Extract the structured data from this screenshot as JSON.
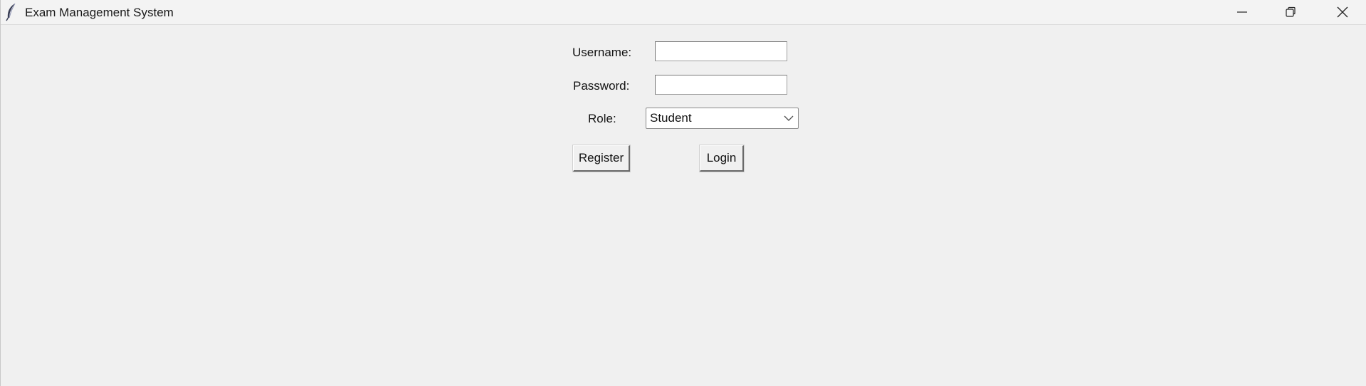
{
  "window": {
    "title": "Exam Management System",
    "icon": "feather-icon",
    "controls": [
      "minimize-icon",
      "restore-icon",
      "close-icon"
    ]
  },
  "form": {
    "username_label": "Username:",
    "username_value": "",
    "password_label": "Password:",
    "password_value": "",
    "role_label": "Role:",
    "role_selected": "Student",
    "register_label": "Register",
    "login_label": "Login"
  }
}
